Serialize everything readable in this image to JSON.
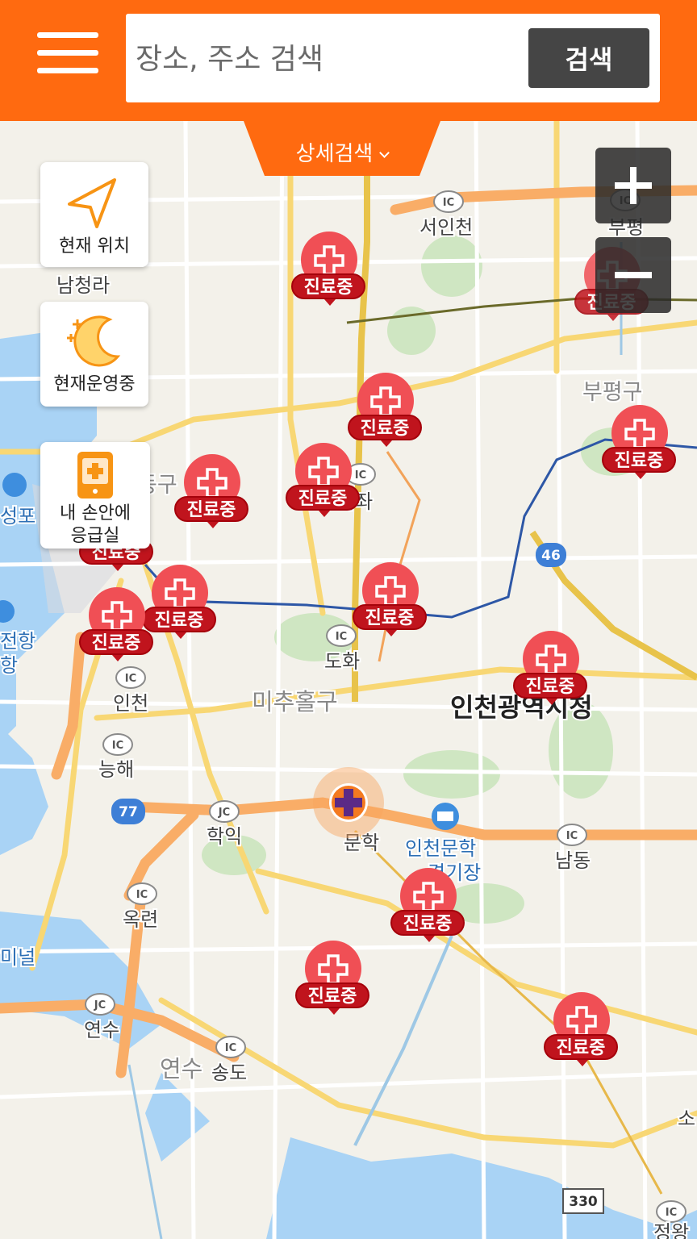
{
  "header": {
    "search_placeholder": "장소, 주소 검색",
    "search_button": "검색",
    "detail_search": "상세검색",
    "accent_color": "#ff6a10"
  },
  "side_buttons": {
    "current_location": "현재 위치",
    "open_now": "현재운영중",
    "emergency_room_line1": "내 손안에",
    "emergency_room_line2": "응급실"
  },
  "zoom": {
    "in": "+",
    "out": "−"
  },
  "pin_label": "진료중",
  "map_labels": {
    "seoincheon": "서인천",
    "bupyeong_ic": "부평",
    "namcheongna": "남청라",
    "bupyeonggu": "부평구",
    "donggu": "동구",
    "gajwa": "가좌",
    "seongpo": "성포",
    "ganghang1": "전항",
    "ganghang2": "항",
    "doha": "도화",
    "incheon_ic": "인천",
    "michuholgu": "미추홀구",
    "city_hall": "인천광역시청",
    "neunghae": "능해",
    "hakik": "학익",
    "munhak": "문학",
    "stadium1": "인천문학",
    "stadium2": "경기장",
    "namdong": "남동",
    "okryeon": "옥련",
    "terminal": "미널",
    "yeonsu_jc": "연수",
    "yeonsu": "연수",
    "songdo": "송도",
    "jeongwang": "정왕",
    "so": "소",
    "route_46": "46",
    "route_77": "77",
    "route_330": "330",
    "ic": "IC",
    "jc": "JC"
  }
}
